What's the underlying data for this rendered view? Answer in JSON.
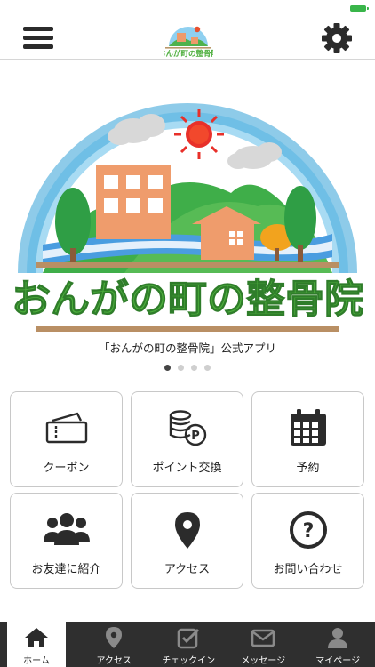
{
  "header": {
    "menu_icon": "hamburger-menu-icon",
    "settings_icon": "gear-icon",
    "logo_icon": "clinic-logo"
  },
  "hero": {
    "logo_text": "おんがの町の整骨院",
    "caption": "「おんがの町の整骨院」公式アプリ",
    "slide_count": 4,
    "active_slide": 1
  },
  "grid": {
    "items": [
      {
        "label": "クーポン",
        "icon": "ticket-icon"
      },
      {
        "label": "ポイント交換",
        "icon": "coin-stack-icon"
      },
      {
        "label": "予約",
        "icon": "calendar-icon"
      },
      {
        "label": "お友達に紹介",
        "icon": "users-icon"
      },
      {
        "label": "アクセス",
        "icon": "map-pin-icon"
      },
      {
        "label": "お問い合わせ",
        "icon": "question-circle-icon"
      }
    ]
  },
  "tabbar": {
    "items": [
      {
        "label": "ホーム",
        "icon": "home-icon",
        "active": true
      },
      {
        "label": "アクセス",
        "icon": "map-pin-icon",
        "active": false
      },
      {
        "label": "チェックイン",
        "icon": "checkin-icon",
        "active": false
      },
      {
        "label": "メッセージ",
        "icon": "envelope-icon",
        "active": false
      },
      {
        "label": "マイページ",
        "icon": "user-icon",
        "active": false
      }
    ]
  },
  "colors": {
    "tabbar_bg": "#2f2f2f",
    "sky": "#6ec1ea",
    "hill_green": "#3fae49",
    "building_orange": "#ee9a6a",
    "logo_green": "#4cae3c",
    "logo_orange": "#e8502e"
  }
}
